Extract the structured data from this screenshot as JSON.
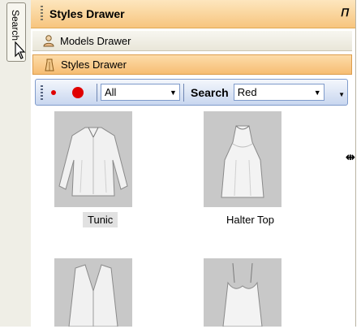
{
  "side_tab": {
    "label": "Search"
  },
  "panel": {
    "title": "Styles Drawer",
    "pin_icon": "pin-icon",
    "drawers": [
      {
        "label": "Models Drawer",
        "icon": "person-icon"
      },
      {
        "label": "Styles Drawer",
        "icon": "dress-icon"
      }
    ]
  },
  "toolbar": {
    "filter_value": "All",
    "search_label": "Search",
    "search_value": "Red",
    "accent_color": "#e00000"
  },
  "items": [
    {
      "label": "Tunic",
      "selected": true
    },
    {
      "label": "Halter Top",
      "selected": false
    },
    {
      "label": "",
      "selected": false
    },
    {
      "label": "",
      "selected": false
    }
  ]
}
